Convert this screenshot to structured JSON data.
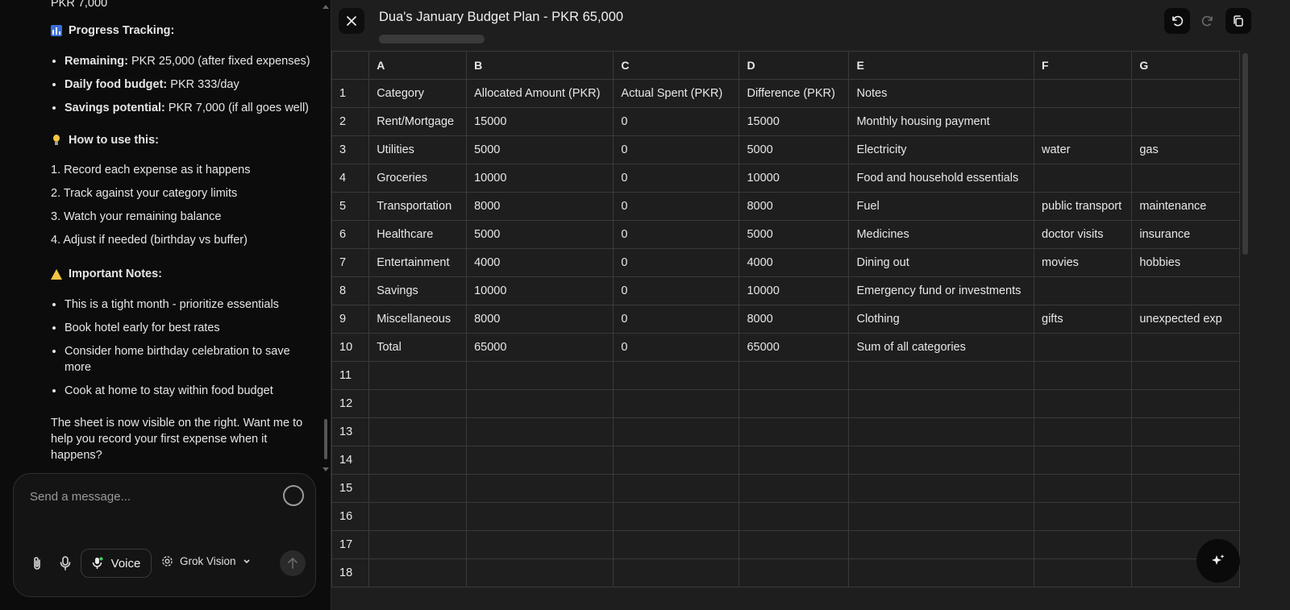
{
  "chat": {
    "top_fragment": "PKR 7,000",
    "progress": {
      "heading": "Progress Tracking:",
      "icon": "bar-chart-icon",
      "items": [
        {
          "label": "Remaining:",
          "text": " PKR 25,000 (after fixed expenses)"
        },
        {
          "label": "Daily food budget:",
          "text": " PKR 333/day"
        },
        {
          "label": "Savings potential:",
          "text": " PKR 7,000 (if all goes well)"
        }
      ]
    },
    "howto": {
      "heading": "How to use this:",
      "icon": "lightbulb-icon",
      "items": [
        "1. Record each expense as it happens",
        "2. Track against your category limits",
        "3. Watch your remaining balance",
        "4. Adjust if needed (birthday vs buffer)"
      ]
    },
    "notes": {
      "heading": "Important Notes:",
      "icon": "warning-icon",
      "items": [
        "This is a tight month - prioritize essentials",
        "Book hotel early for best rates",
        "Consider home birthday celebration to save more",
        "Cook at home to stay within food budget"
      ]
    },
    "closing": "The sheet is now visible on the right. Want me to help you record your first expense when it happens?"
  },
  "composer": {
    "placeholder": "Send a message...",
    "voice_label": "Voice",
    "model_label": "Grok Vision"
  },
  "sheet": {
    "title": "Dua's January Budget Plan - PKR 65,000",
    "columns": [
      "A",
      "B",
      "C",
      "D",
      "E",
      "F",
      "G"
    ],
    "rows": [
      [
        "1",
        "Category",
        "Allocated Amount (PKR)",
        "Actual Spent (PKR)",
        "Difference (PKR)",
        "Notes",
        "",
        ""
      ],
      [
        "2",
        "Rent/Mortgage",
        "15000",
        "0",
        "15000",
        "Monthly housing payment",
        "",
        ""
      ],
      [
        "3",
        "Utilities",
        "5000",
        "0",
        "5000",
        "Electricity",
        "water",
        "gas"
      ],
      [
        "4",
        "Groceries",
        "10000",
        "0",
        "10000",
        "Food and household essentials",
        "",
        ""
      ],
      [
        "5",
        "Transportation",
        "8000",
        "0",
        "8000",
        "Fuel",
        "public transport",
        "maintenance"
      ],
      [
        "6",
        "Healthcare",
        "5000",
        "0",
        "5000",
        "Medicines",
        "doctor visits",
        "insurance"
      ],
      [
        "7",
        "Entertainment",
        "4000",
        "0",
        "4000",
        "Dining out",
        "movies",
        "hobbies"
      ],
      [
        "8",
        "Savings",
        "10000",
        "0",
        "10000",
        "Emergency fund or investments",
        "",
        ""
      ],
      [
        "9",
        "Miscellaneous",
        "8000",
        "0",
        "8000",
        "Clothing",
        "gifts",
        "unexpected exp"
      ],
      [
        "10",
        "Total",
        "65000",
        "0",
        "65000",
        "Sum of all categories",
        "",
        ""
      ],
      [
        "11",
        "",
        "",
        "",
        "",
        "",
        "",
        ""
      ],
      [
        "12",
        "",
        "",
        "",
        "",
        "",
        "",
        ""
      ],
      [
        "13",
        "",
        "",
        "",
        "",
        "",
        "",
        ""
      ],
      [
        "14",
        "",
        "",
        "",
        "",
        "",
        "",
        ""
      ],
      [
        "15",
        "",
        "",
        "",
        "",
        "",
        "",
        ""
      ],
      [
        "16",
        "",
        "",
        "",
        "",
        "",
        "",
        ""
      ],
      [
        "17",
        "",
        "",
        "",
        "",
        "",
        "",
        ""
      ],
      [
        "18",
        "",
        "",
        "",
        "",
        "",
        "",
        ""
      ]
    ]
  }
}
